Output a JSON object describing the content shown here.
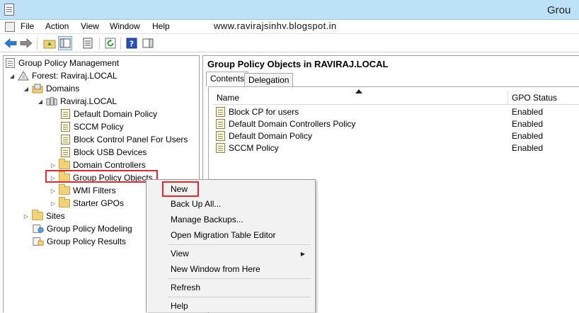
{
  "window": {
    "title": "Grou"
  },
  "menubar": {
    "items": [
      "File",
      "Action",
      "View",
      "Window",
      "Help"
    ],
    "watermark": "www.ravirajsinhv.blogspot.in"
  },
  "toolbar": {
    "buttons": [
      "back-arrow-icon",
      "forward-arrow-icon",
      "up-folder-icon",
      "show-hide-tree-icon",
      "properties-icon",
      "refresh-icon",
      "help-icon",
      "action-pane-icon"
    ]
  },
  "tree": {
    "root": "Group Policy Management",
    "forest": "Forest: Raviraj.LOCAL",
    "domains": "Domains",
    "domain": "Raviraj.LOCAL",
    "domain_children": [
      "Default Domain Policy",
      "SCCM Policy",
      "Block Control Panel For Users",
      "Block USB Devices"
    ],
    "domain_controllers": "Domain Controllers",
    "gpo": "Group Policy Objects",
    "wmi": "WMI Filters",
    "starter": "Starter GPOs",
    "sites": "Sites",
    "modeling": "Group Policy Modeling",
    "results": "Group Policy Results"
  },
  "right": {
    "title": "Group Policy Objects in  RAVIRAJ.LOCAL",
    "tabs": [
      "Contents",
      "Delegation"
    ],
    "columns": [
      "Name",
      "GPO Status"
    ],
    "rows": [
      {
        "name": "Block CP for users",
        "status": "Enabled"
      },
      {
        "name": "Default Domain Controllers Policy",
        "status": "Enabled"
      },
      {
        "name": "Default Domain Policy",
        "status": "Enabled"
      },
      {
        "name": "SCCM Policy",
        "status": "Enabled"
      }
    ]
  },
  "context_menu": {
    "items": [
      "New",
      "Back Up All...",
      "Manage Backups...",
      "Open Migration Table Editor",
      "View",
      "New Window from Here",
      "Refresh",
      "Help"
    ]
  },
  "colors": {
    "highlight": "#e5262e",
    "titlebar": "#bde2f7"
  }
}
